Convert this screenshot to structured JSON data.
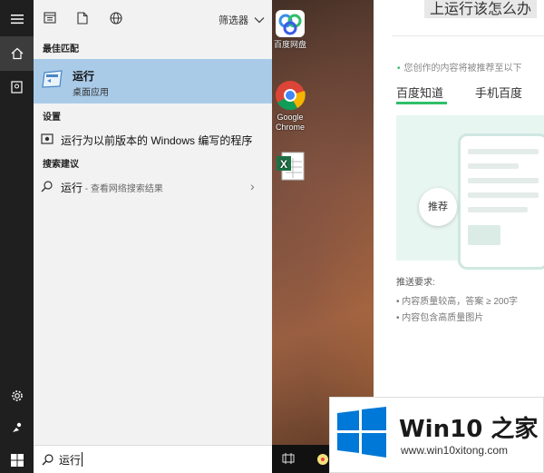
{
  "start_menu": {
    "filter_label": "筛选器",
    "sections": {
      "best_match": "最佳匹配",
      "settings": "设置",
      "search_suggestions": "搜索建议"
    },
    "best_match_item": {
      "name": "运行",
      "subtitle": "桌面应用"
    },
    "settings_item": {
      "label": "运行为以前版本的 Windows 编写的程序"
    },
    "suggestion_item": {
      "label": "运行",
      "hint": " - 查看网络搜索结果"
    },
    "search": {
      "value": "运行"
    }
  },
  "desktop": {
    "icons": [
      {
        "label": "百度网盘",
        "icon": "baidu-netdisk-icon"
      },
      {
        "label": "Google Chrome",
        "icon": "chrome-icon"
      },
      {
        "label": "",
        "icon": "excel-icon"
      }
    ]
  },
  "browser": {
    "title": "上运行该怎么办",
    "note": "您创作的内容将被推荐至以下",
    "tabs": [
      "百度知道",
      "手机百度"
    ],
    "recommend_label": "推荐",
    "requirements_title": "推送要求:",
    "requirements": [
      "内容质量较高，答案 ≥ 200字",
      "内容包含高质量图片"
    ]
  },
  "watermark": {
    "brand": "Win10 之家",
    "url": "www.win10xitong.com"
  },
  "colors": {
    "accent_green": "#2fbf6a",
    "selection_blue": "#a9cbe8",
    "windows_blue": "#0078d7"
  }
}
